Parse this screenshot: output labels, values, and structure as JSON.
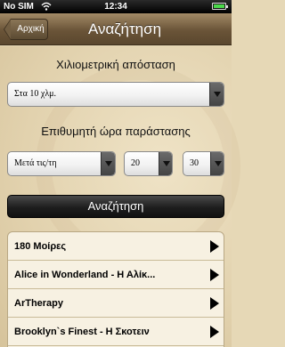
{
  "status_bar": {
    "carrier": "No SIM",
    "time": "12:34"
  },
  "nav": {
    "back_label": "Αρχική",
    "title": "Αναζήτηση"
  },
  "form": {
    "distance_label": "Χιλιομετρική απόσταση",
    "distance_value": "Στα 10 χλμ.",
    "time_label": "Επιθυμητή ώρα παράστασης",
    "time_mode_value": "Μετά τις/τη",
    "hour_value": "20",
    "minute_value": "30",
    "search_label": "Αναζήτηση"
  },
  "results": [
    {
      "title": "180 Μοίρες"
    },
    {
      "title": "Alice in Wonderland - Η Αλίκ..."
    },
    {
      "title": "ArTherapy"
    },
    {
      "title": "Brooklyn`s Finest - Η Σκοτειν"
    }
  ],
  "colors": {
    "nav_bar": "#6a5438",
    "background": "#e6d8b6",
    "search_button": "#1e1e1e"
  }
}
